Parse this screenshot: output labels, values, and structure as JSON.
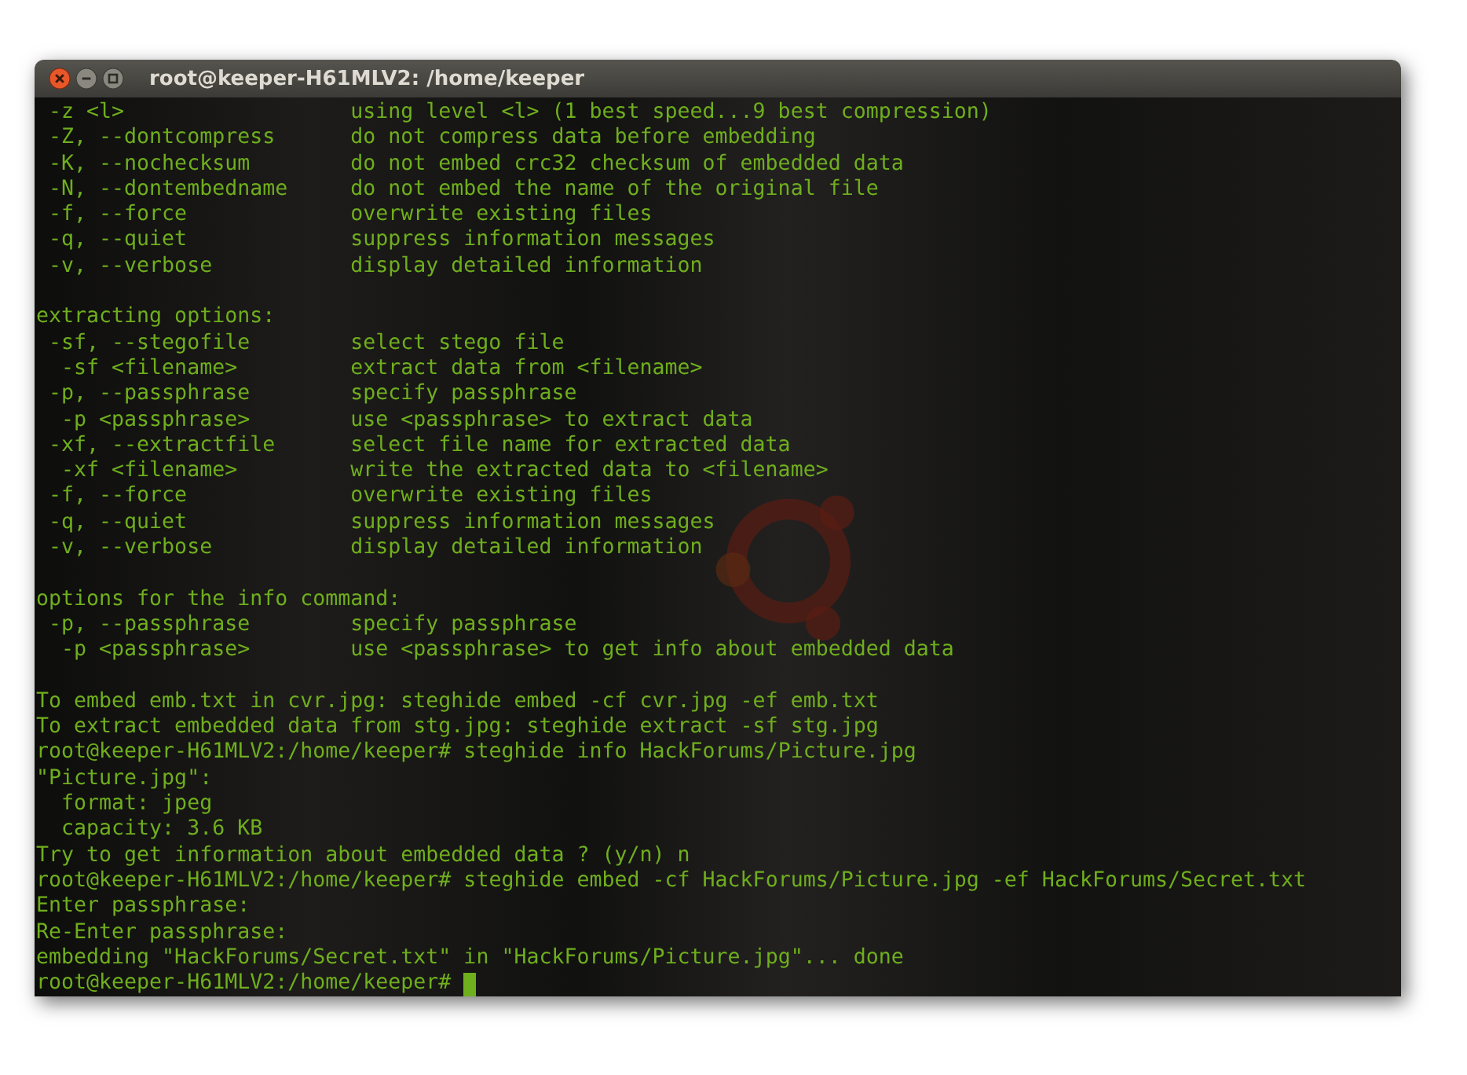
{
  "window": {
    "title": "root@keeper-H61MLV2: /home/keeper"
  },
  "blocks": [
    {
      "lines": [
        {
          "kind": "option",
          "option": " -z <l>",
          "description": "using level <l> (1 best speed...9 best compression)"
        },
        {
          "kind": "option",
          "option": " -Z, --dontcompress",
          "description": "do not compress data before embedding"
        },
        {
          "kind": "option",
          "option": " -K, --nochecksum",
          "description": "do not embed crc32 checksum of embedded data"
        },
        {
          "kind": "option",
          "option": " -N, --dontembedname",
          "description": "do not embed the name of the original file"
        },
        {
          "kind": "option",
          "option": " -f, --force",
          "description": "overwrite existing files"
        },
        {
          "kind": "option",
          "option": " -q, --quiet",
          "description": "suppress information messages"
        },
        {
          "kind": "option",
          "option": " -v, --verbose",
          "description": "display detailed information"
        }
      ]
    },
    {
      "lines": [
        {
          "kind": "line",
          "text": "extracting options:"
        },
        {
          "kind": "option",
          "option": " -sf, --stegofile",
          "description": "select stego file"
        },
        {
          "kind": "option",
          "option": "  -sf <filename>",
          "description": "extract data from <filename>"
        },
        {
          "kind": "option",
          "option": " -p, --passphrase",
          "description": "specify passphrase"
        },
        {
          "kind": "option",
          "option": "  -p <passphrase>",
          "description": "use <passphrase> to extract data"
        },
        {
          "kind": "option",
          "option": " -xf, --extractfile",
          "description": "select file name for extracted data"
        },
        {
          "kind": "option",
          "option": "  -xf <filename>",
          "description": "write the extracted data to <filename>"
        },
        {
          "kind": "option",
          "option": " -f, --force",
          "description": "overwrite existing files"
        },
        {
          "kind": "option",
          "option": " -q, --quiet",
          "description": "suppress information messages"
        },
        {
          "kind": "option",
          "option": " -v, --verbose",
          "description": "display detailed information"
        }
      ]
    },
    {
      "lines": [
        {
          "kind": "line",
          "text": "options for the info command:"
        },
        {
          "kind": "option",
          "option": " -p, --passphrase",
          "description": "specify passphrase"
        },
        {
          "kind": "option",
          "option": "  -p <passphrase>",
          "description": "use <passphrase> to get info about embedded data"
        }
      ]
    },
    {
      "lines": [
        {
          "kind": "line",
          "text": "To embed emb.txt in cvr.jpg: steghide embed -cf cvr.jpg -ef emb.txt"
        },
        {
          "kind": "line",
          "text": "To extract embedded data from stg.jpg: steghide extract -sf stg.jpg"
        },
        {
          "kind": "line",
          "text": "root@keeper-H61MLV2:/home/keeper# steghide info HackForums/Picture.jpg"
        },
        {
          "kind": "line",
          "text": "\"Picture.jpg\":"
        },
        {
          "kind": "line",
          "text": "  format: jpeg"
        },
        {
          "kind": "line",
          "text": "  capacity: 3.6 KB"
        },
        {
          "kind": "line",
          "text": "Try to get information about embedded data ? (y/n) n"
        },
        {
          "kind": "line",
          "text": "root@keeper-H61MLV2:/home/keeper# steghide embed -cf HackForums/Picture.jpg -ef HackForums/Secret.txt"
        },
        {
          "kind": "line",
          "text": "Enter passphrase:"
        },
        {
          "kind": "line",
          "text": "Re-Enter passphrase:"
        },
        {
          "kind": "line",
          "text": "embedding \"HackForums/Secret.txt\" in \"HackForums/Picture.jpg\"... done"
        },
        {
          "kind": "prompt",
          "text": "root@keeper-H61MLV2:/home/keeper#"
        }
      ]
    }
  ]
}
